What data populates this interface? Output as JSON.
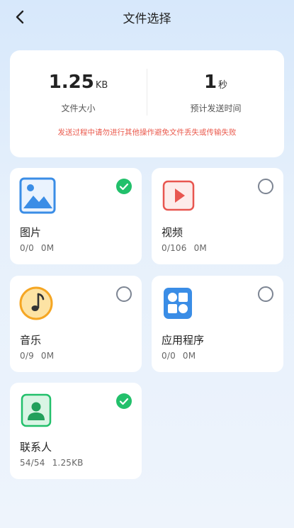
{
  "header": {
    "title": "文件选择"
  },
  "summary": {
    "size_value": "1.25",
    "size_unit": "KB",
    "size_label": "文件大小",
    "time_value": "1",
    "time_unit": "秒",
    "time_label": "预计发送时间",
    "warning": "发送过程中请勿进行其他操作避免文件丢失或传输失败"
  },
  "categories": [
    {
      "name": "图片",
      "count": "0/0",
      "size": "0M",
      "selected": true,
      "icon": "image-icon"
    },
    {
      "name": "视频",
      "count": "0/106",
      "size": "0M",
      "selected": false,
      "icon": "video-icon"
    },
    {
      "name": "音乐",
      "count": "0/9",
      "size": "0M",
      "selected": false,
      "icon": "music-icon"
    },
    {
      "name": "应用程序",
      "count": "0/0",
      "size": "0M",
      "selected": false,
      "icon": "apps-icon"
    },
    {
      "name": "联系人",
      "count": "54/54",
      "size": "1.25KB",
      "selected": true,
      "icon": "contact-icon"
    }
  ],
  "colors": {
    "check_green": "#22c06b",
    "warning_red": "#ea5a4d",
    "image_blue": "#3a8de6",
    "video_red": "#e8564f",
    "music_orange": "#f5a623"
  }
}
